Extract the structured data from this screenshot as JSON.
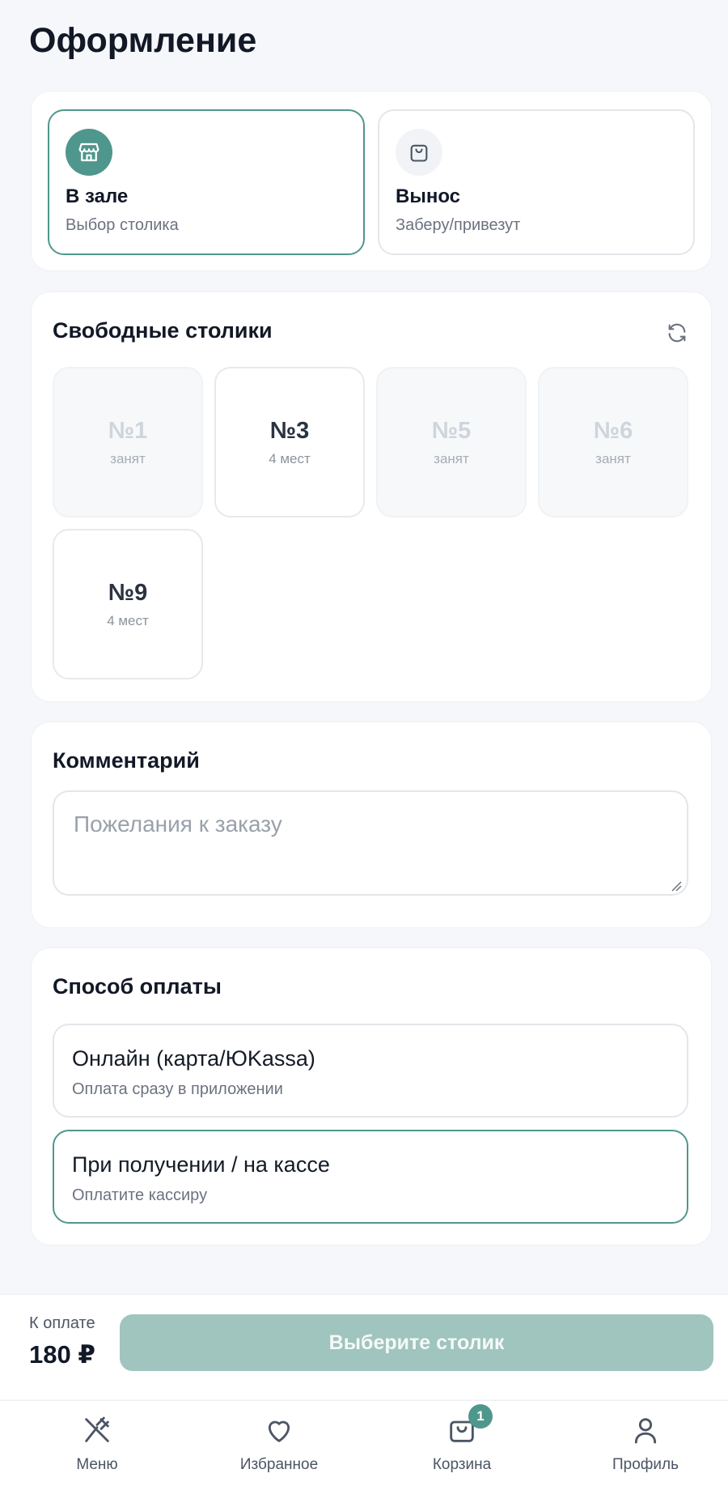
{
  "page": {
    "title": "Оформление"
  },
  "order_type": {
    "options": [
      {
        "title": "В зале",
        "subtitle": "Выбор столика",
        "icon": "store-icon",
        "selected": true
      },
      {
        "title": "Вынос",
        "subtitle": "Заберу/привезут",
        "icon": "shopping-bag-icon",
        "selected": false
      }
    ]
  },
  "tables": {
    "title": "Свободные столики",
    "refresh_icon": "refresh-icon",
    "items": [
      {
        "number": "№1",
        "status": "занят",
        "busy": true
      },
      {
        "number": "№3",
        "status": "4 мест",
        "busy": false
      },
      {
        "number": "№5",
        "status": "занят",
        "busy": true
      },
      {
        "number": "№6",
        "status": "занят",
        "busy": true
      },
      {
        "number": "№9",
        "status": "4 мест",
        "busy": false
      }
    ]
  },
  "comment": {
    "title": "Комментарий",
    "placeholder": "Пожелания к заказу",
    "value": ""
  },
  "payment": {
    "title": "Способ оплаты",
    "options": [
      {
        "title": "Онлайн (карта/ЮKassa)",
        "subtitle": "Оплата сразу в приложении",
        "selected": false
      },
      {
        "title": "При получении / на кассе",
        "subtitle": "Оплатите кассиру",
        "selected": true
      }
    ]
  },
  "checkout": {
    "total_label": "К оплате",
    "total_value": "180 ₽",
    "button_label": "Выберите столик"
  },
  "tabbar": {
    "items": [
      {
        "label": "Меню",
        "icon": "fork-knife-icon"
      },
      {
        "label": "Избранное",
        "icon": "heart-icon"
      },
      {
        "label": "Корзина",
        "icon": "basket-icon",
        "badge": "1"
      },
      {
        "label": "Профиль",
        "icon": "user-icon"
      }
    ]
  },
  "colors": {
    "accent": "#4f978c",
    "button_disabled": "#a0c4be",
    "background": "#f5f7fa"
  }
}
